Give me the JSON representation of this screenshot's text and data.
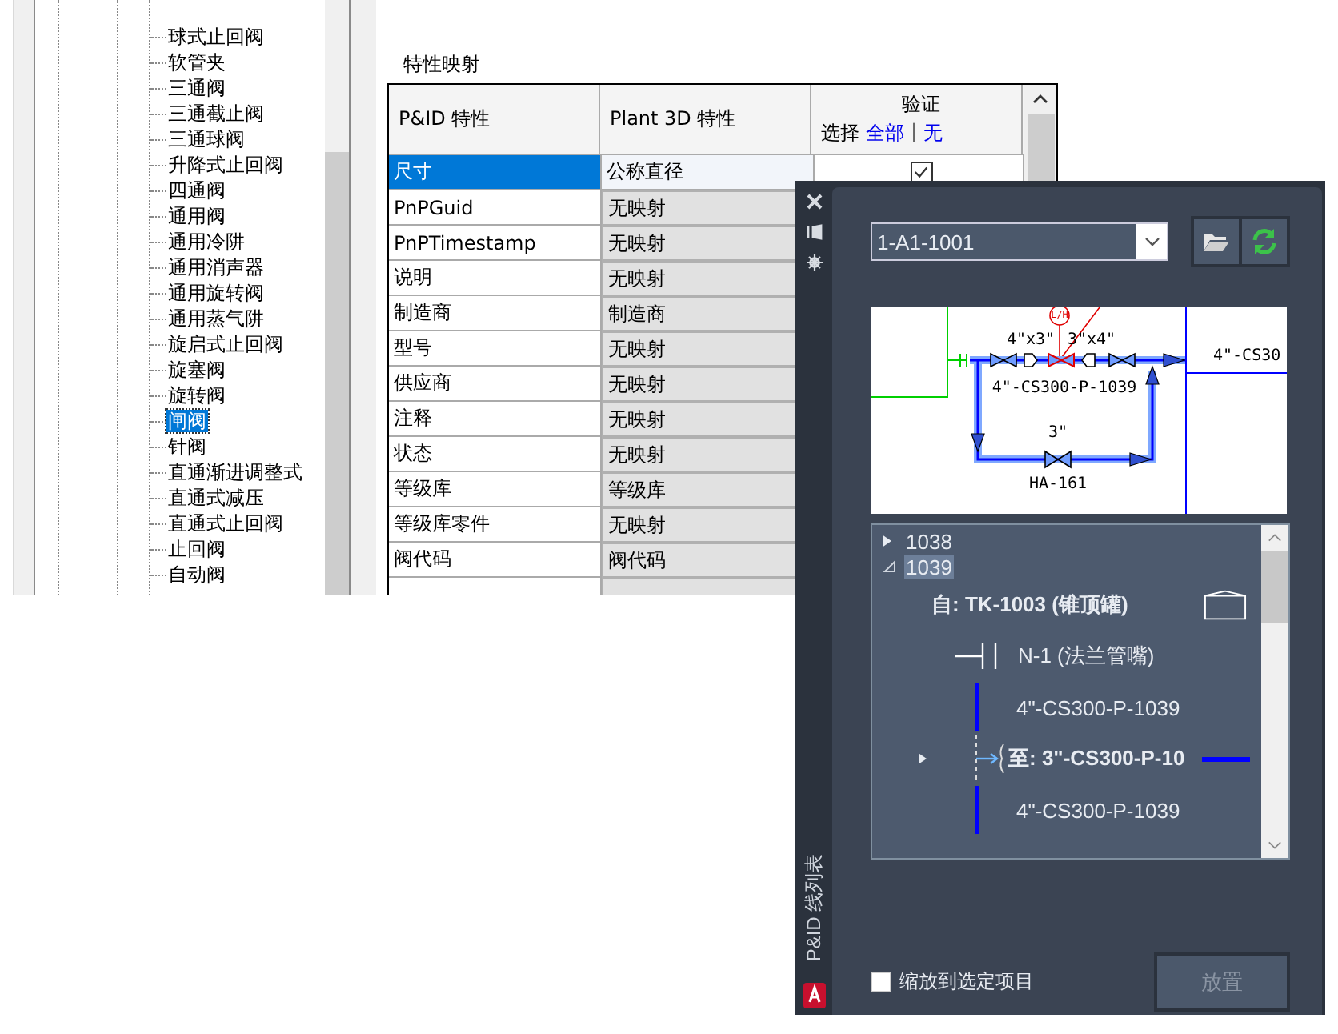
{
  "valve_tree": {
    "items": [
      {
        "label": "球式止回阀",
        "selected": false
      },
      {
        "label": "软管夹",
        "selected": false
      },
      {
        "label": "三通阀",
        "selected": false
      },
      {
        "label": "三通截止阀",
        "selected": false
      },
      {
        "label": "三通球阀",
        "selected": false
      },
      {
        "label": "升降式止回阀",
        "selected": false
      },
      {
        "label": "四通阀",
        "selected": false
      },
      {
        "label": "通用阀",
        "selected": false
      },
      {
        "label": "通用冷阱",
        "selected": false
      },
      {
        "label": "通用消声器",
        "selected": false
      },
      {
        "label": "通用旋转阀",
        "selected": false
      },
      {
        "label": "通用蒸气阱",
        "selected": false
      },
      {
        "label": "旋启式止回阀",
        "selected": false
      },
      {
        "label": "旋塞阀",
        "selected": false
      },
      {
        "label": "旋转阀",
        "selected": false
      },
      {
        "label": "闸阀",
        "selected": true
      },
      {
        "label": "针阀",
        "selected": false
      },
      {
        "label": "直通渐进调整式",
        "selected": false
      },
      {
        "label": "直通式减压",
        "selected": false
      },
      {
        "label": "直通式止回阀",
        "selected": false
      },
      {
        "label": "止回阀",
        "selected": false
      },
      {
        "label": "自动阀",
        "selected": false
      }
    ]
  },
  "property_mapping": {
    "title": "特性映射",
    "columns": [
      "P&ID 特性",
      "Plant 3D 特性"
    ],
    "validate_header": "验证",
    "select_label": "选择",
    "select_all": "全部",
    "select_separator": "|",
    "select_none": "无",
    "rows": [
      {
        "pid": "尺寸",
        "plant": "公称直径",
        "selected": true,
        "checked": true
      },
      {
        "pid": "PnPGuid",
        "plant": "无映射",
        "selected": false
      },
      {
        "pid": "PnPTimestamp",
        "plant": "无映射",
        "selected": false
      },
      {
        "pid": "说明",
        "plant": "无映射",
        "selected": false
      },
      {
        "pid": "制造商",
        "plant": "制造商",
        "selected": false
      },
      {
        "pid": "型号",
        "plant": "无映射",
        "selected": false
      },
      {
        "pid": "供应商",
        "plant": "无映射",
        "selected": false
      },
      {
        "pid": "注释",
        "plant": "无映射",
        "selected": false
      },
      {
        "pid": "状态",
        "plant": "无映射",
        "selected": false
      },
      {
        "pid": "等级库",
        "plant": "等级库",
        "selected": false
      },
      {
        "pid": "等级库零件",
        "plant": "无映射",
        "selected": false
      },
      {
        "pid": "阀代码",
        "plant": "阀代码",
        "selected": false
      }
    ]
  },
  "palette": {
    "title": "P&ID 线列表",
    "drawing_select": "1-A1-1001",
    "preview": {
      "labels": [
        "L/H",
        "4\"x3\"",
        "3\"x4\"",
        "4\"-CS300-P-1039",
        "3\"",
        "HA-161",
        "4\"-CS30"
      ]
    },
    "tree": [
      {
        "label": "1038",
        "kind": "group",
        "expanded": false,
        "selected": false
      },
      {
        "label": "1039",
        "kind": "group",
        "expanded": true,
        "selected": true,
        "children": [
          {
            "label": "自: TK-1003 (锥顶罐)",
            "kind": "from"
          },
          {
            "label": "N-1 (法兰管嘴)",
            "kind": "nozzle"
          },
          {
            "label": "4\"-CS300-P-1039",
            "kind": "pipe"
          },
          {
            "label": "至: 3\"-CS300-P-10",
            "kind": "branch",
            "expanded": false
          },
          {
            "label": "4\"-CS300-P-1039",
            "kind": "pipe"
          }
        ]
      }
    ],
    "zoom_checkbox": {
      "label": "缩放到选定项目",
      "checked": false
    },
    "place_button": {
      "label": "放置",
      "disabled": true
    }
  }
}
